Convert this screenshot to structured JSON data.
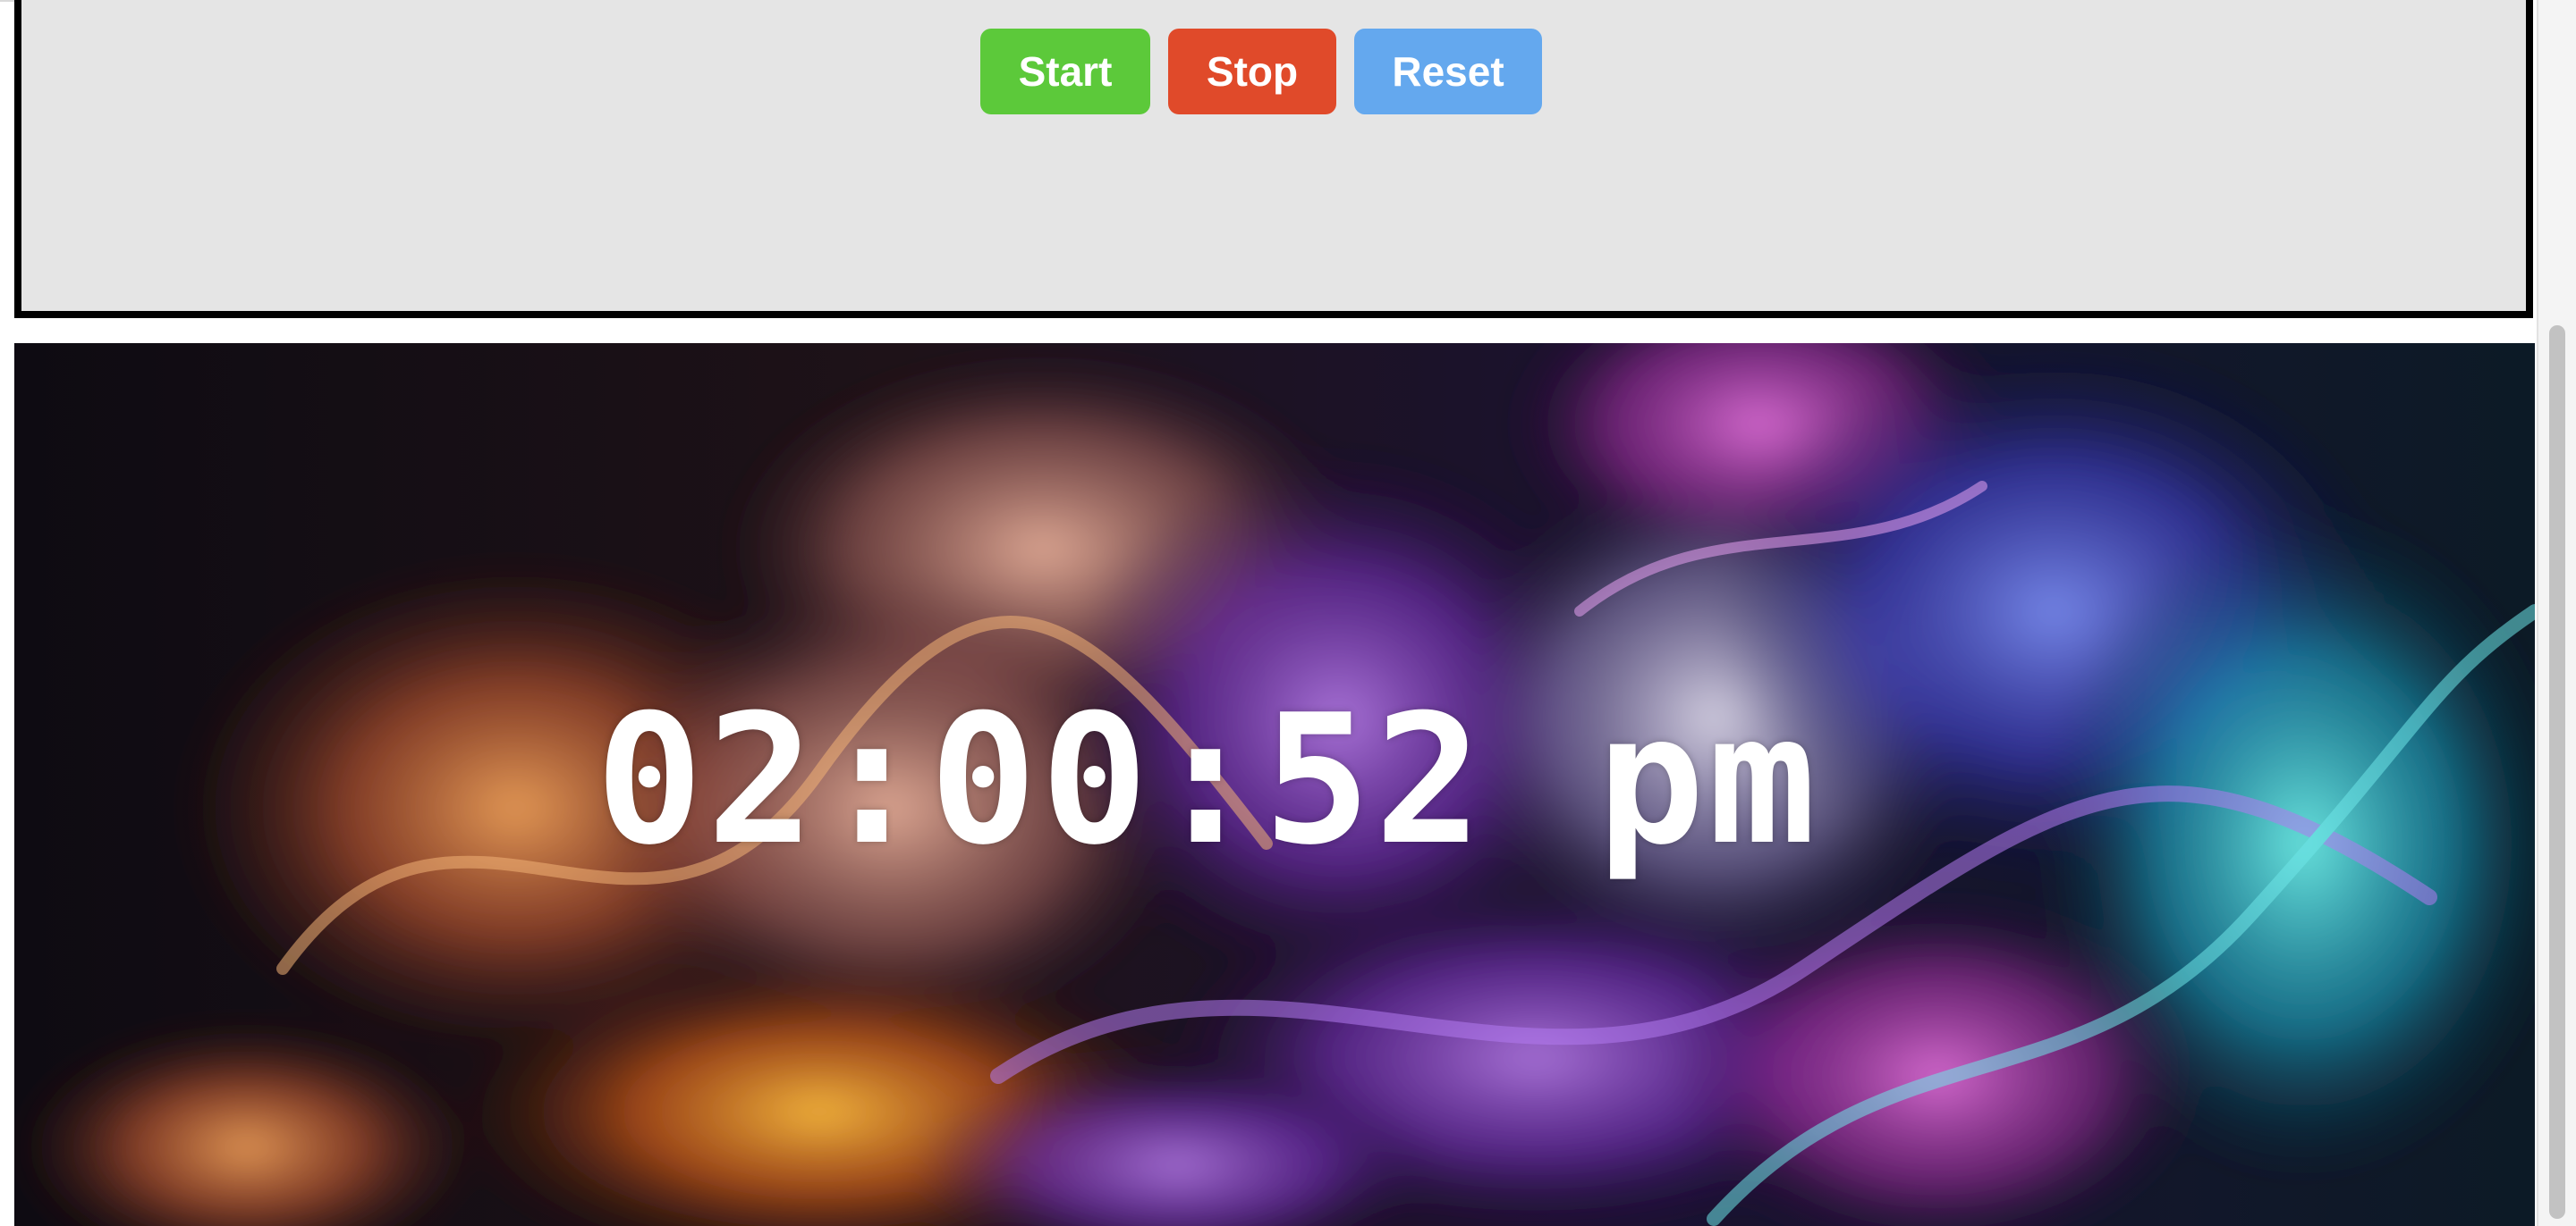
{
  "controls": {
    "start_label": "Start",
    "stop_label": "Stop",
    "reset_label": "Reset",
    "start_color": "#5cc93a",
    "stop_color": "#e04a2a",
    "reset_color": "#64a8ee"
  },
  "clock": {
    "time": "02:00:52 pm"
  },
  "banner": {
    "background": "abstract-colorful-smoke-image"
  }
}
